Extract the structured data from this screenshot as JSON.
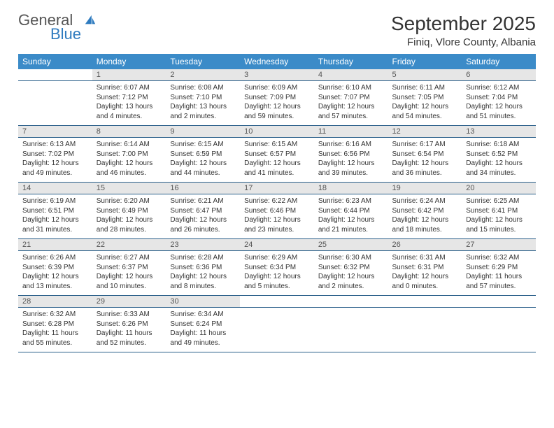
{
  "brand": {
    "name1": "General",
    "name2": "Blue"
  },
  "title": "September 2025",
  "location": "Finiq, Vlore County, Albania",
  "weekdays": [
    "Sunday",
    "Monday",
    "Tuesday",
    "Wednesday",
    "Thursday",
    "Friday",
    "Saturday"
  ],
  "chart_data": {
    "type": "table",
    "title": "September 2025 Sunrise/Sunset/Daylight — Finiq, Vlore County, Albania",
    "columns": [
      "day",
      "sunrise",
      "sunset",
      "daylight"
    ],
    "rows": [
      {
        "day": 1,
        "sunrise": "6:07 AM",
        "sunset": "7:12 PM",
        "daylight": "13 hours and 4 minutes"
      },
      {
        "day": 2,
        "sunrise": "6:08 AM",
        "sunset": "7:10 PM",
        "daylight": "13 hours and 2 minutes"
      },
      {
        "day": 3,
        "sunrise": "6:09 AM",
        "sunset": "7:09 PM",
        "daylight": "12 hours and 59 minutes"
      },
      {
        "day": 4,
        "sunrise": "6:10 AM",
        "sunset": "7:07 PM",
        "daylight": "12 hours and 57 minutes"
      },
      {
        "day": 5,
        "sunrise": "6:11 AM",
        "sunset": "7:05 PM",
        "daylight": "12 hours and 54 minutes"
      },
      {
        "day": 6,
        "sunrise": "6:12 AM",
        "sunset": "7:04 PM",
        "daylight": "12 hours and 51 minutes"
      },
      {
        "day": 7,
        "sunrise": "6:13 AM",
        "sunset": "7:02 PM",
        "daylight": "12 hours and 49 minutes"
      },
      {
        "day": 8,
        "sunrise": "6:14 AM",
        "sunset": "7:00 PM",
        "daylight": "12 hours and 46 minutes"
      },
      {
        "day": 9,
        "sunrise": "6:15 AM",
        "sunset": "6:59 PM",
        "daylight": "12 hours and 44 minutes"
      },
      {
        "day": 10,
        "sunrise": "6:15 AM",
        "sunset": "6:57 PM",
        "daylight": "12 hours and 41 minutes"
      },
      {
        "day": 11,
        "sunrise": "6:16 AM",
        "sunset": "6:56 PM",
        "daylight": "12 hours and 39 minutes"
      },
      {
        "day": 12,
        "sunrise": "6:17 AM",
        "sunset": "6:54 PM",
        "daylight": "12 hours and 36 minutes"
      },
      {
        "day": 13,
        "sunrise": "6:18 AM",
        "sunset": "6:52 PM",
        "daylight": "12 hours and 34 minutes"
      },
      {
        "day": 14,
        "sunrise": "6:19 AM",
        "sunset": "6:51 PM",
        "daylight": "12 hours and 31 minutes"
      },
      {
        "day": 15,
        "sunrise": "6:20 AM",
        "sunset": "6:49 PM",
        "daylight": "12 hours and 28 minutes"
      },
      {
        "day": 16,
        "sunrise": "6:21 AM",
        "sunset": "6:47 PM",
        "daylight": "12 hours and 26 minutes"
      },
      {
        "day": 17,
        "sunrise": "6:22 AM",
        "sunset": "6:46 PM",
        "daylight": "12 hours and 23 minutes"
      },
      {
        "day": 18,
        "sunrise": "6:23 AM",
        "sunset": "6:44 PM",
        "daylight": "12 hours and 21 minutes"
      },
      {
        "day": 19,
        "sunrise": "6:24 AM",
        "sunset": "6:42 PM",
        "daylight": "12 hours and 18 minutes"
      },
      {
        "day": 20,
        "sunrise": "6:25 AM",
        "sunset": "6:41 PM",
        "daylight": "12 hours and 15 minutes"
      },
      {
        "day": 21,
        "sunrise": "6:26 AM",
        "sunset": "6:39 PM",
        "daylight": "12 hours and 13 minutes"
      },
      {
        "day": 22,
        "sunrise": "6:27 AM",
        "sunset": "6:37 PM",
        "daylight": "12 hours and 10 minutes"
      },
      {
        "day": 23,
        "sunrise": "6:28 AM",
        "sunset": "6:36 PM",
        "daylight": "12 hours and 8 minutes"
      },
      {
        "day": 24,
        "sunrise": "6:29 AM",
        "sunset": "6:34 PM",
        "daylight": "12 hours and 5 minutes"
      },
      {
        "day": 25,
        "sunrise": "6:30 AM",
        "sunset": "6:32 PM",
        "daylight": "12 hours and 2 minutes"
      },
      {
        "day": 26,
        "sunrise": "6:31 AM",
        "sunset": "6:31 PM",
        "daylight": "12 hours and 0 minutes"
      },
      {
        "day": 27,
        "sunrise": "6:32 AM",
        "sunset": "6:29 PM",
        "daylight": "11 hours and 57 minutes"
      },
      {
        "day": 28,
        "sunrise": "6:32 AM",
        "sunset": "6:28 PM",
        "daylight": "11 hours and 55 minutes"
      },
      {
        "day": 29,
        "sunrise": "6:33 AM",
        "sunset": "6:26 PM",
        "daylight": "11 hours and 52 minutes"
      },
      {
        "day": 30,
        "sunrise": "6:34 AM",
        "sunset": "6:24 PM",
        "daylight": "11 hours and 49 minutes"
      }
    ]
  },
  "labels": {
    "sunrise": "Sunrise:",
    "sunset": "Sunset:",
    "daylight": "Daylight:"
  },
  "start_weekday": 1,
  "colors": {
    "header_bg": "#3b8bc8",
    "daynum_bg": "#e6e6e6",
    "rule": "#2a5f8a"
  }
}
